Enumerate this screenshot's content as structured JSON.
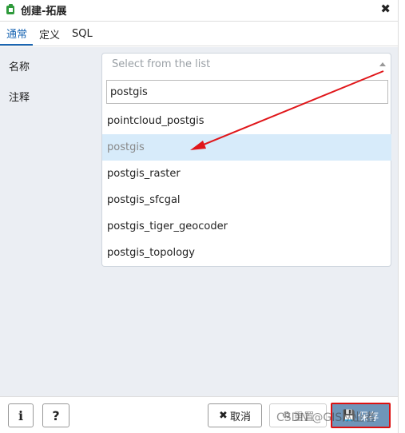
{
  "window": {
    "title": "创建-拓展",
    "close_symbol": "✖"
  },
  "tabs": [
    {
      "label": "通常",
      "active": true
    },
    {
      "label": "定义",
      "active": false
    },
    {
      "label": "SQL",
      "active": false
    }
  ],
  "form": {
    "name_label": "名称",
    "comment_label": "注释",
    "select_placeholder": "Select from the list",
    "search_value": "postgis",
    "options": [
      "pointcloud_postgis",
      "postgis",
      "postgis_raster",
      "postgis_sfcgal",
      "postgis_tiger_geocoder",
      "postgis_topology"
    ],
    "highlighted_option": "postgis"
  },
  "footer": {
    "info_label": "i",
    "help_label": "?",
    "cancel_label": "取消",
    "cancel_icon": "✖",
    "reset_label": "重置",
    "save_label": "保存"
  },
  "watermark": "CSDN @GIS从业者",
  "colors": {
    "accent": "#1a66b3",
    "highlight": "#d7ebfa",
    "arrow": "#e0161a",
    "save_bg": "#6f95b9"
  }
}
